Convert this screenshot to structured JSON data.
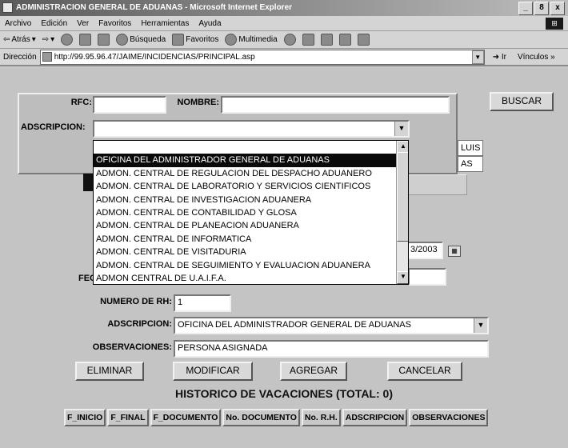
{
  "window": {
    "title": "ADMINISTRACION GENERAL DE ADUANAS - Microsoft Internet Explorer",
    "controls": [
      "_",
      "8",
      "x"
    ]
  },
  "menu": [
    "Archivo",
    "Edición",
    "Ver",
    "Favoritos",
    "Herramientas",
    "Ayuda"
  ],
  "toolbar": {
    "back": "Atrás",
    "search": "Búsqueda",
    "favorites": "Favoritos",
    "multimedia": "Multimedia"
  },
  "address": {
    "label": "Dirección",
    "url": "http://99.95.96.47/JAIME/INCIDENCIAS/PRINCIPAL.asp",
    "go": "Ir",
    "links": "Vínculos »"
  },
  "search_panel": {
    "rfc_label": "RFC:",
    "rfc_value": "",
    "nombre_label": "NOMBRE:",
    "nombre_value": "",
    "adscripcion_label": "ADSCRIPCION:",
    "adscripcion_value": "",
    "buscar_label": "BUSCAR"
  },
  "dropdown": {
    "options": [
      "",
      "OFICINA DEL ADMINISTRADOR GENERAL DE ADUANAS",
      "ADMON. CENTRAL DE REGULACION DEL DESPACHO ADUANERO",
      "ADMON. CENTRAL DE LABORATORIO Y SERVICIOS CIENTIFICOS",
      "ADMON. CENTRAL DE INVESTIGACION ADUANERA",
      "ADMON. CENTRAL DE CONTABILIDAD Y GLOSA",
      "ADMON. CENTRAL DE PLANEACION ADUANERA",
      "ADMON. CENTRAL DE INFORMATICA",
      "ADMON. CENTRAL DE VISITADURIA",
      "ADMON. CENTRAL DE SEGUIMIENTO Y EVALUACION ADUANERA",
      "ADMON CENTRAL DE U.A.I.F.A."
    ],
    "selected_index": 1
  },
  "partial": {
    "luis": "LUIS",
    "as": "AS",
    "date_fragment": "3/2003",
    "fec_label": "FEC"
  },
  "form": {
    "numero_rh_label": "NUMERO DE RH:",
    "numero_rh_value": "1",
    "adscripcion_label": "ADSCRIPCION:",
    "adscripcion_value": "OFICINA DEL ADMINISTRADOR GENERAL DE ADUANAS",
    "observaciones_label": "OBSERVACIONES:",
    "observaciones_value": "PERSONA ASIGNADA"
  },
  "actions": {
    "eliminar": "ELIMINAR",
    "modificar": "MODIFICAR",
    "agregar": "AGREGAR",
    "cancelar": "CANCELAR"
  },
  "history": {
    "title": "HISTORICO DE VACACIONES (TOTAL: 0)",
    "columns": [
      "F_INICIO",
      "F_FINAL",
      "F_DOCUMENTO",
      "No. DOCUMENTO",
      "No. R.H.",
      "ADSCRIPCION",
      "OBSERVACIONES"
    ]
  }
}
